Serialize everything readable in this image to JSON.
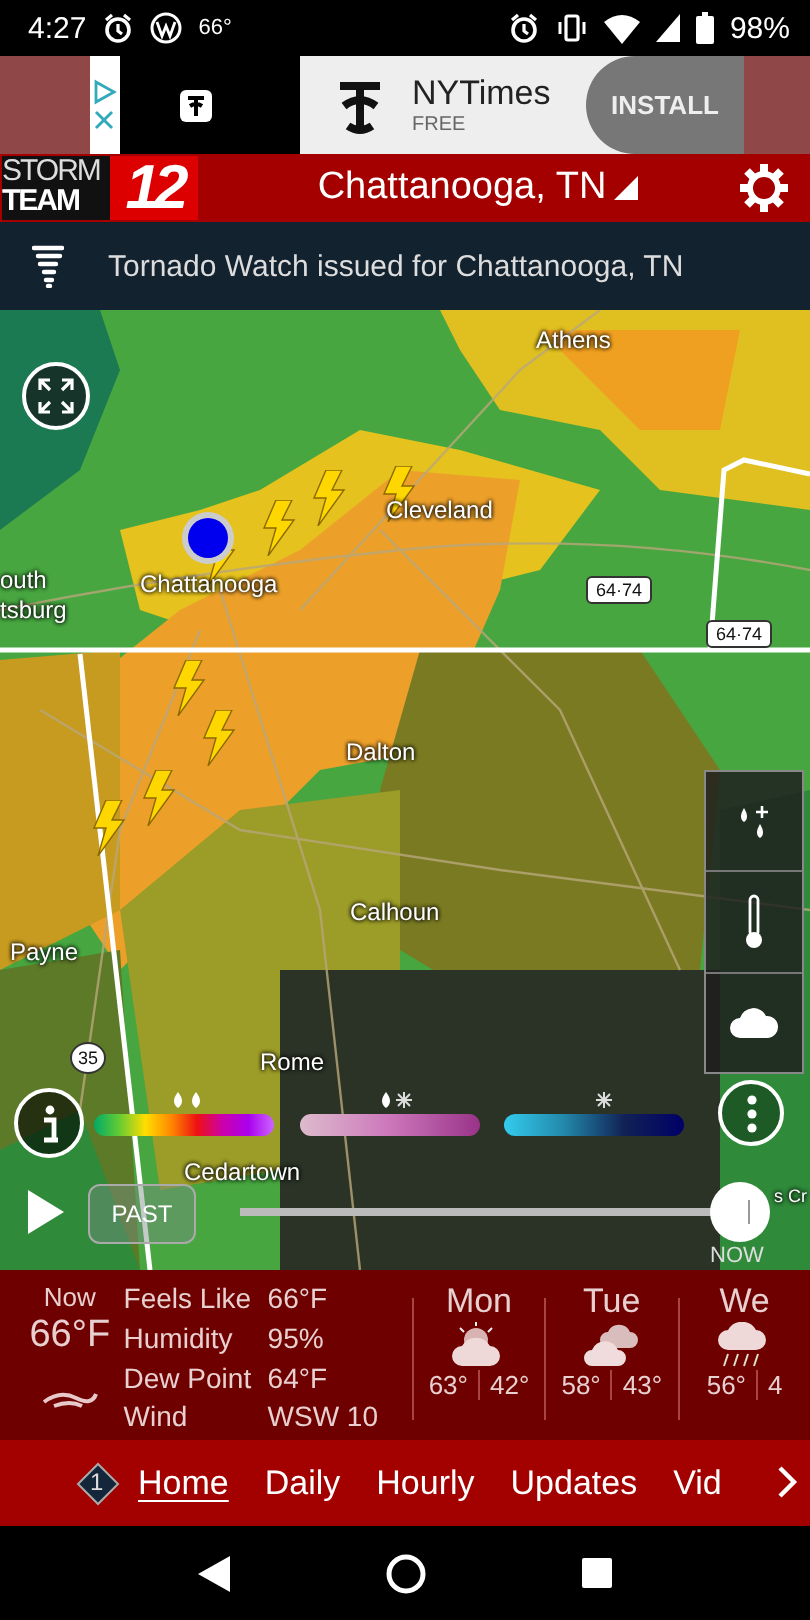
{
  "status_bar": {
    "time": "4:27",
    "temperature": "66°",
    "battery": "98%"
  },
  "ad": {
    "title": "NYTimes",
    "subtitle": "FREE",
    "button": "INSTALL"
  },
  "header": {
    "logo": {
      "top": "STORM",
      "bottom": "TEAM",
      "number": "12"
    },
    "location": "Chattanooga, TN"
  },
  "alert": {
    "text": "Tornado Watch issued for Chattanooga, TN"
  },
  "map": {
    "labels": [
      "Athens",
      "Cleveland",
      "Chattanooga",
      "outh",
      "tsburg",
      "Dalton",
      "Calhoun",
      "Payne",
      "Rome",
      "Cedartown",
      "s Cr"
    ],
    "shields": [
      "64·74",
      "64·74",
      "35"
    ],
    "timeline": {
      "past_label": "PAST",
      "now_label": "NOW",
      "level": 1
    }
  },
  "current": {
    "label": "Now",
    "temperature": "66°F",
    "details": [
      {
        "label": "Feels Like",
        "value": "66°F"
      },
      {
        "label": "Humidity",
        "value": "95%"
      },
      {
        "label": "Dew Point",
        "value": "64°F"
      },
      {
        "label": "Wind",
        "value": "WSW 10"
      }
    ]
  },
  "forecast": [
    {
      "day": "Mon",
      "kind": "partly-sunny",
      "high": "63°",
      "low": "42°"
    },
    {
      "day": "Tue",
      "kind": "cloudy",
      "high": "58°",
      "low": "43°"
    },
    {
      "day": "We",
      "kind": "rain",
      "high": "56°",
      "low": "4"
    }
  ],
  "nav": {
    "badge": "1",
    "tabs": [
      {
        "label": "Home",
        "selected": true
      },
      {
        "label": "Daily",
        "selected": false
      },
      {
        "label": "Hourly",
        "selected": false
      },
      {
        "label": "Updates",
        "selected": false
      },
      {
        "label": "Vid",
        "selected": false
      }
    ]
  }
}
